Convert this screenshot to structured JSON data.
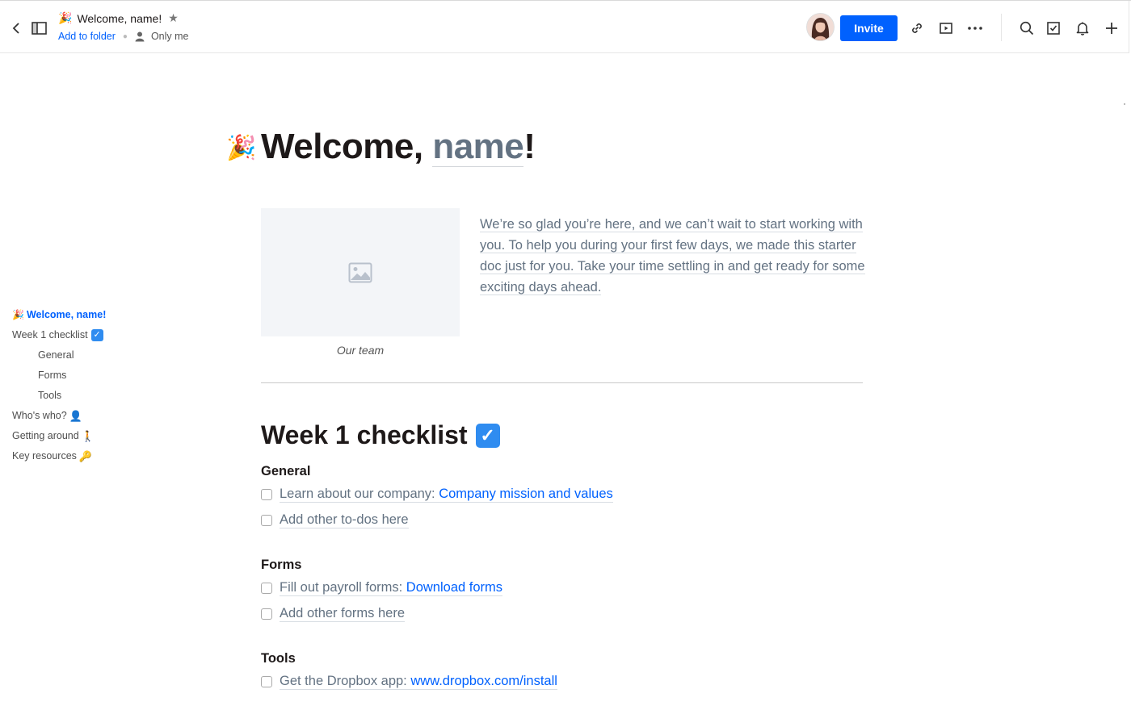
{
  "header": {
    "doc_emoji": "🎉",
    "doc_title": "Welcome, name!",
    "add_to_folder": "Add to folder",
    "sharing": "Only me",
    "invite_label": "Invite"
  },
  "toc": {
    "items": [
      {
        "label": "Welcome, name!",
        "emoji_before": "🎉"
      },
      {
        "label": "Week 1 checklist",
        "emoji_after": "✓"
      },
      {
        "label": "General"
      },
      {
        "label": "Forms"
      },
      {
        "label": "Tools"
      },
      {
        "label": "Who's who?",
        "emoji_after": "👤"
      },
      {
        "label": "Getting around",
        "emoji_after": "🚶"
      },
      {
        "label": "Key resources",
        "emoji_after": "🔑"
      }
    ]
  },
  "doc": {
    "title_emoji": "🎉",
    "title_prefix": "Welcome, ",
    "title_name": "name",
    "title_suffix": "!",
    "image_caption": "Our team",
    "intro": "We’re so glad you’re here, and we can’t wait to start working with you. To help you during your first few days, we made this starter doc just for you. Take your time settling in and get ready for some exciting days ahead.",
    "checklist_heading": "Week 1 checklist",
    "checklist_emoji": "✓",
    "sections": [
      {
        "heading": "General",
        "todos": [
          {
            "text": "Learn about our company: ",
            "link": "Company mission and values"
          },
          {
            "text": "Add other to-dos here"
          }
        ]
      },
      {
        "heading": "Forms",
        "todos": [
          {
            "text": "Fill out payroll forms: ",
            "link": "Download forms"
          },
          {
            "text": "Add other forms here"
          }
        ]
      },
      {
        "heading": "Tools",
        "todos": [
          {
            "text": "Get the Dropbox app: ",
            "link": "www.dropbox.com/install"
          }
        ]
      }
    ]
  },
  "colors": {
    "accent": "#0061fe",
    "muted_text": "#637282",
    "checkbox_emoji_bg": "#2f8cf0"
  },
  "icons": [
    "chevron-left-icon",
    "sidebar-toggle-icon",
    "star-icon",
    "person-icon",
    "link-icon",
    "present-icon",
    "more-icon",
    "search-icon",
    "checkbox-icon",
    "bell-icon",
    "plus-icon",
    "image-placeholder-icon"
  ]
}
